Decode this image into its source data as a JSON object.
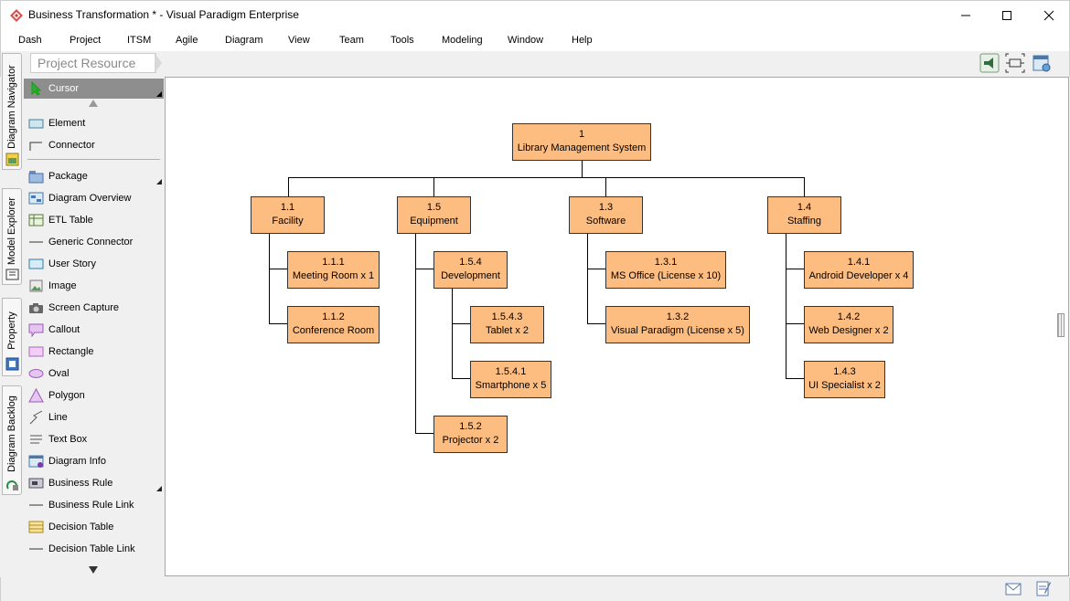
{
  "window": {
    "title": "Business Transformation * - Visual Paradigm Enterprise"
  },
  "menu": [
    "Dash",
    "Project",
    "ITSM",
    "Agile",
    "Diagram",
    "View",
    "Team",
    "Tools",
    "Modeling",
    "Window",
    "Help"
  ],
  "breadcrumb": {
    "label": "Project Resource"
  },
  "side_tabs": [
    "Diagram Navigator",
    "Model Explorer",
    "Property",
    "Diagram Backlog"
  ],
  "palette": {
    "cursor": "Cursor",
    "items": [
      "Element",
      "Connector",
      "Package",
      "Diagram Overview",
      "ETL Table",
      "Generic Connector",
      "User Story",
      "Image",
      "Screen Capture",
      "Callout",
      "Rectangle",
      "Oval",
      "Polygon",
      "Line",
      "Text Box",
      "Diagram Info",
      "Business Rule",
      "Business Rule Link",
      "Decision Table",
      "Decision Table Link"
    ]
  },
  "colors": {
    "node_fill": "#fdbc80",
    "node_border": "#333333",
    "accent": "#c0392b"
  },
  "diagram": {
    "nodes": {
      "root": {
        "id": "1",
        "name": "Library Management System"
      },
      "n1_1": {
        "id": "1.1",
        "name": "Facility"
      },
      "n1_1_1": {
        "id": "1.1.1",
        "name": "Meeting Room x 1"
      },
      "n1_1_2": {
        "id": "1.1.2",
        "name": "Conference Room"
      },
      "n1_5": {
        "id": "1.5",
        "name": "Equipment"
      },
      "n1_5_4": {
        "id": "1.5.4",
        "name": "Development"
      },
      "n1_5_4_3": {
        "id": "1.5.4.3",
        "name": "Tablet x 2"
      },
      "n1_5_4_1": {
        "id": "1.5.4.1",
        "name": "Smartphone x 5"
      },
      "n1_5_2": {
        "id": "1.5.2",
        "name": "Projector x 2"
      },
      "n1_3": {
        "id": "1.3",
        "name": "Software"
      },
      "n1_3_1": {
        "id": "1.3.1",
        "name": "MS Office (License x 10)"
      },
      "n1_3_2": {
        "id": "1.3.2",
        "name": "Visual Paradigm (License x 5)"
      },
      "n1_4": {
        "id": "1.4",
        "name": "Staffing"
      },
      "n1_4_1": {
        "id": "1.4.1",
        "name": "Android Developer x 4"
      },
      "n1_4_2": {
        "id": "1.4.2",
        "name": "Web Designer x 2"
      },
      "n1_4_3": {
        "id": "1.4.3",
        "name": "UI Specialist x 2"
      }
    }
  }
}
